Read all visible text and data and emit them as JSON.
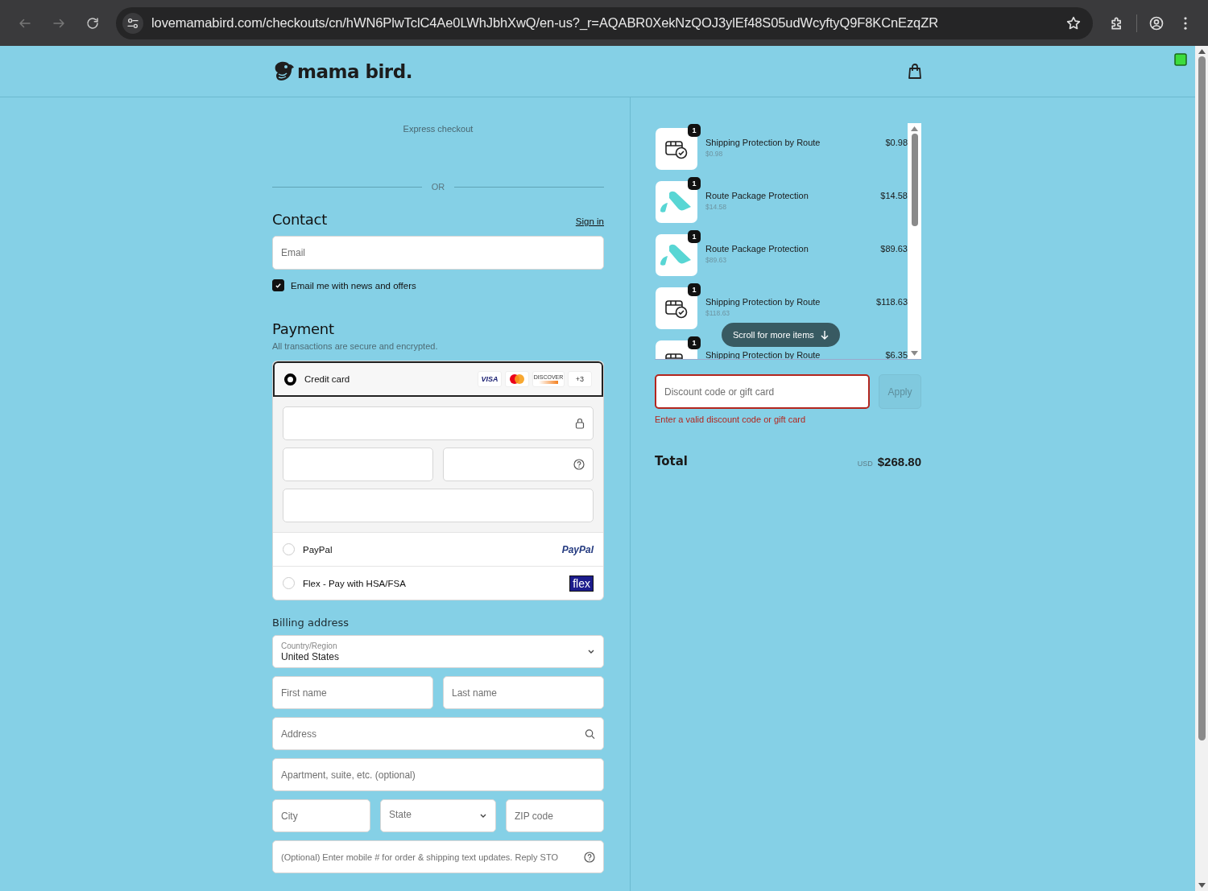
{
  "browser": {
    "url": "lovemamabird.com/checkouts/cn/hWN6PlwTclC4Ae0LWhJbhXwQ/en-us?_r=AQABR0XekNzQOJ3ylEf48S05udWcyftyQ9F8KCnEzqZR"
  },
  "header": {
    "logo": "mama bird."
  },
  "express_checkout": {
    "label": "Express checkout"
  },
  "divider": {
    "label": "OR"
  },
  "contact": {
    "title": "Contact",
    "sign_in": "Sign in",
    "email": {
      "placeholder": "Email"
    },
    "newsletter": {
      "label": "Email me with news and offers",
      "checked": true
    }
  },
  "payment": {
    "title": "Payment",
    "subtitle": "All transactions are secure and encrypted.",
    "methods": [
      {
        "kind": "card",
        "label": "Credit card",
        "selected": true,
        "brands": [
          {
            "kind": "visa",
            "label": "VISA"
          },
          {
            "kind": "mastercard"
          },
          {
            "kind": "discover",
            "label": "DISCOVER"
          },
          {
            "kind": "more",
            "label": "+3"
          }
        ]
      },
      {
        "kind": "paypal",
        "label": "PayPal",
        "logo": "PayPal",
        "selected": false
      },
      {
        "kind": "flex",
        "label": "Flex - Pay with HSA/FSA",
        "logo": "flex",
        "selected": false
      }
    ]
  },
  "billing": {
    "title": "Billing address",
    "rows": [
      [
        {
          "kind": "select",
          "label": "Country/Region",
          "value": "United States"
        }
      ],
      [
        {
          "kind": "text",
          "placeholder": "First name"
        },
        {
          "kind": "text",
          "placeholder": "Last name"
        }
      ],
      [
        {
          "kind": "search",
          "placeholder": "Address"
        }
      ],
      [
        {
          "kind": "text",
          "placeholder": "Apartment, suite, etc. (optional)"
        }
      ],
      [
        {
          "kind": "text",
          "placeholder": "City"
        },
        {
          "kind": "select",
          "placeholder": "State"
        },
        {
          "kind": "text",
          "placeholder": "ZIP code"
        }
      ],
      [
        {
          "kind": "help",
          "placeholder": "(Optional) Enter mobile # for order & shipping text updates. Reply STO"
        }
      ]
    ]
  },
  "order": {
    "items": [
      {
        "kind": "shipping",
        "quantity": "1",
        "title": "Shipping Protection by Route",
        "subtitle": "$0.98",
        "price": "$0.98"
      },
      {
        "kind": "route",
        "quantity": "1",
        "title": "Route Package Protection",
        "subtitle": "$14.58",
        "price": "$14.58"
      },
      {
        "kind": "route",
        "quantity": "1",
        "title": "Route Package Protection",
        "subtitle": "$89.63",
        "price": "$89.63"
      },
      {
        "kind": "shipping",
        "quantity": "1",
        "title": "Shipping Protection by Route",
        "subtitle": "$118.63",
        "price": "$118.63"
      },
      {
        "kind": "shipping",
        "quantity": "1",
        "title": "Shipping Protection by Route",
        "price": "$6.35"
      }
    ],
    "scroll_hint": "Scroll for more items",
    "discount": {
      "placeholder": "Discount code or gift card",
      "error": true,
      "error_message": "Enter a valid discount code or gift card",
      "apply": "Apply",
      "apply_disabled": true
    },
    "total": {
      "label": "Total",
      "currency": "USD",
      "amount": "$268.80"
    }
  }
}
